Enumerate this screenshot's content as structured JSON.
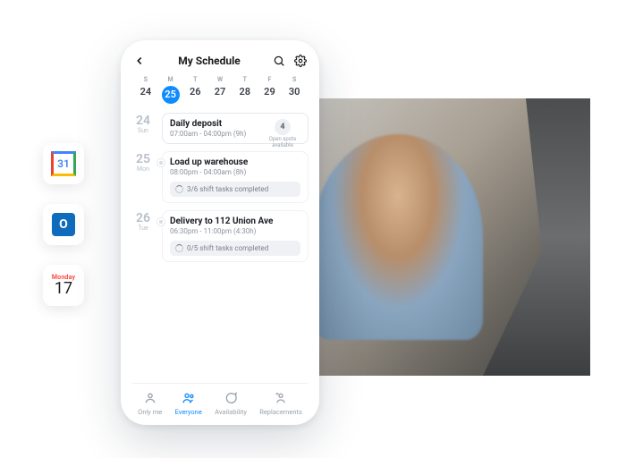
{
  "colors": {
    "accent": "#0f8bff"
  },
  "side_apps": {
    "gcal_day": "31",
    "outlook_letter": "O",
    "apple_month": "Monday",
    "apple_day": "17"
  },
  "header": {
    "title": "My Schedule"
  },
  "week": {
    "labels": [
      "S",
      "M",
      "T",
      "W",
      "T",
      "F",
      "S"
    ],
    "days": [
      "24",
      "25",
      "26",
      "27",
      "28",
      "29",
      "30"
    ],
    "active_index": 1
  },
  "schedule": [
    {
      "date_num": "24",
      "date_wd": "Sun",
      "title": "Daily deposit",
      "time": "07:00am - 04:00pm (9h)",
      "open_spots_count": "4",
      "open_spots_label": "Open spots available",
      "tasks_text": ""
    },
    {
      "date_num": "25",
      "date_wd": "Mon",
      "title": "Load up warehouse",
      "time": "08:00pm - 04:00am (8h)",
      "open_spots_count": "",
      "open_spots_label": "",
      "tasks_text": "3/6 shift tasks completed"
    },
    {
      "date_num": "26",
      "date_wd": "Tue",
      "title": "Delivery to 112 Union Ave",
      "time": "06:30pm - 11:00pm (4:30h)",
      "open_spots_count": "",
      "open_spots_label": "",
      "tasks_text": "0/5 shift tasks completed"
    }
  ],
  "tabs": {
    "only_me": "Only me",
    "everyone": "Everyone",
    "availability": "Availability",
    "replacements": "Replacements"
  }
}
